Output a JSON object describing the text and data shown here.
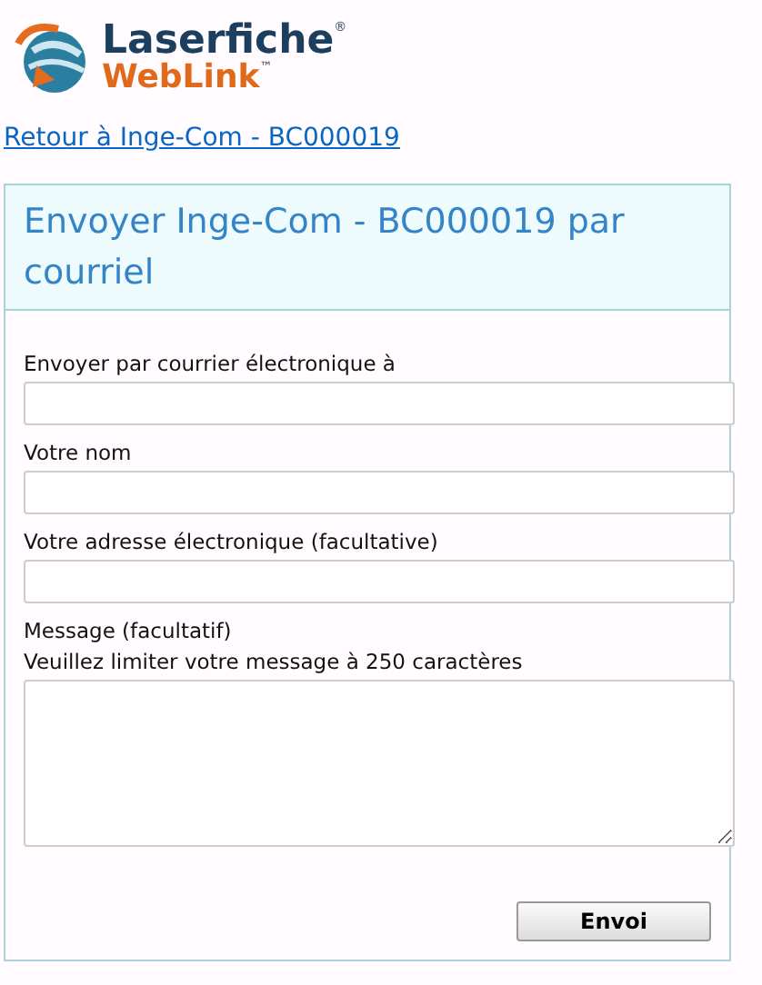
{
  "logo": {
    "brand": "Laserfiche",
    "registered": "®",
    "product": "WebLink",
    "trademark": "™"
  },
  "back_link": "Retour à Inge-Com - BC000019",
  "panel": {
    "title": "Envoyer Inge-Com - BC000019 par courriel",
    "fields": [
      {
        "kind": "input",
        "label": "Envoyer par courrier électronique à"
      },
      {
        "kind": "input",
        "label": "Votre nom"
      },
      {
        "kind": "input",
        "label": "Votre adresse électronique (facultative)"
      },
      {
        "kind": "textarea",
        "label": "Message (facultatif)",
        "hint": "Veuillez limiter votre message à 250 caractères"
      }
    ],
    "submit": "Envoi"
  }
}
